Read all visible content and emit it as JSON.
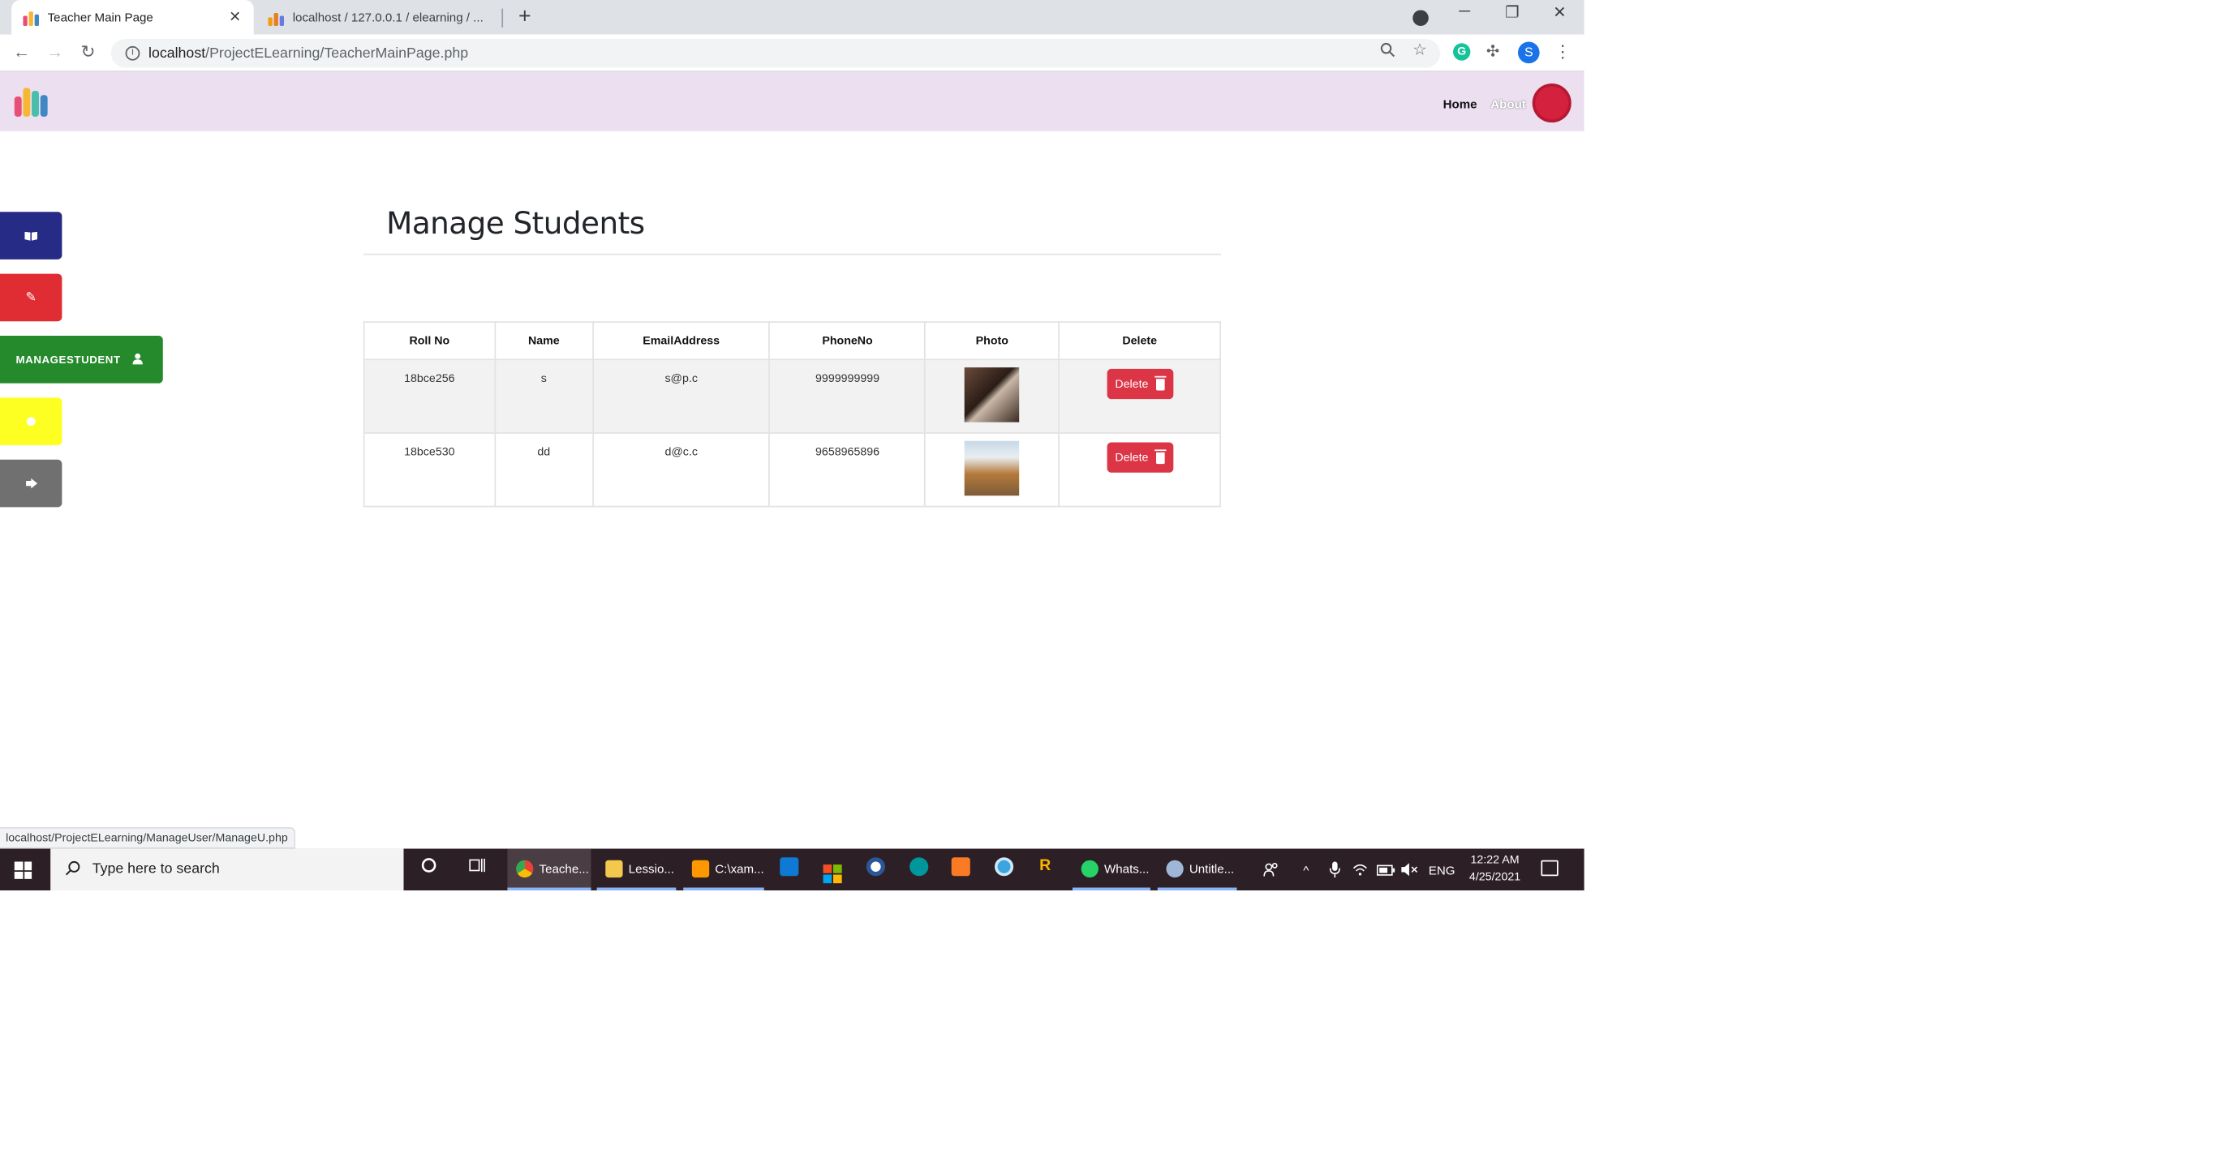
{
  "browser": {
    "tabs": [
      {
        "title": "Teacher Main Page",
        "close": "✕"
      },
      {
        "title": "localhost / 127.0.0.1 / elearning / ..."
      }
    ],
    "new_tab": "+",
    "window_controls": {
      "minimize": "─",
      "restore": "❐",
      "close": "✕"
    },
    "nav": {
      "back": "←",
      "forward": "→",
      "reload": "↻"
    },
    "address": {
      "host": "localhost",
      "path": "/ProjectELearning/TeacherMainPage.php"
    },
    "icons": {
      "zoom": "search-icon",
      "bookmark": "star-icon",
      "extension": "puzzle-icon",
      "menu": "kebab-icon"
    },
    "extension_letter": "G",
    "profile_letter": "S",
    "status_url": "localhost/ProjectELearning/ManageUser/ManageU.php"
  },
  "navbar": {
    "home": "Home",
    "about": "About",
    "logo_colors": [
      "#e94e77",
      "#f7b733",
      "#4abdac",
      "#3f88c5"
    ]
  },
  "sidebar": {
    "items": [
      {
        "name": "book",
        "icon": "book-icon",
        "color": "#262b86"
      },
      {
        "name": "edit",
        "icon": "pencil-icon",
        "color": "#e02d33"
      },
      {
        "name": "managestudent",
        "label": "MANAGESTUDENT",
        "icon": "user-icon",
        "color": "#248a2b"
      },
      {
        "name": "yellow",
        "icon": "circle-icon",
        "color": "#fcff21"
      },
      {
        "name": "logout",
        "icon": "sign-out-icon",
        "color": "#707070"
      }
    ]
  },
  "main": {
    "title": "Manage Students",
    "table": {
      "headers": [
        "Roll No",
        "Name",
        "EmailAddress",
        "PhoneNo",
        "Photo",
        "Delete"
      ],
      "rows": [
        {
          "roll": "18bce256",
          "name": "s",
          "email": "s@p.c",
          "phone": "9999999999",
          "delete": "Delete"
        },
        {
          "roll": "18bce530",
          "name": "dd",
          "email": "d@c.c",
          "phone": "9658965896",
          "delete": "Delete"
        }
      ]
    }
  },
  "taskbar": {
    "search_placeholder": "Type here to search",
    "apps": [
      {
        "label": "Teache..."
      },
      {
        "label": "Lessio..."
      },
      {
        "label": "C:\\xam..."
      },
      {
        "label": "Whats..."
      },
      {
        "label": "Untitle..."
      }
    ],
    "tray": {
      "language": "ENG"
    },
    "clock": {
      "time": "12:22 AM",
      "date": "4/25/2021"
    }
  }
}
